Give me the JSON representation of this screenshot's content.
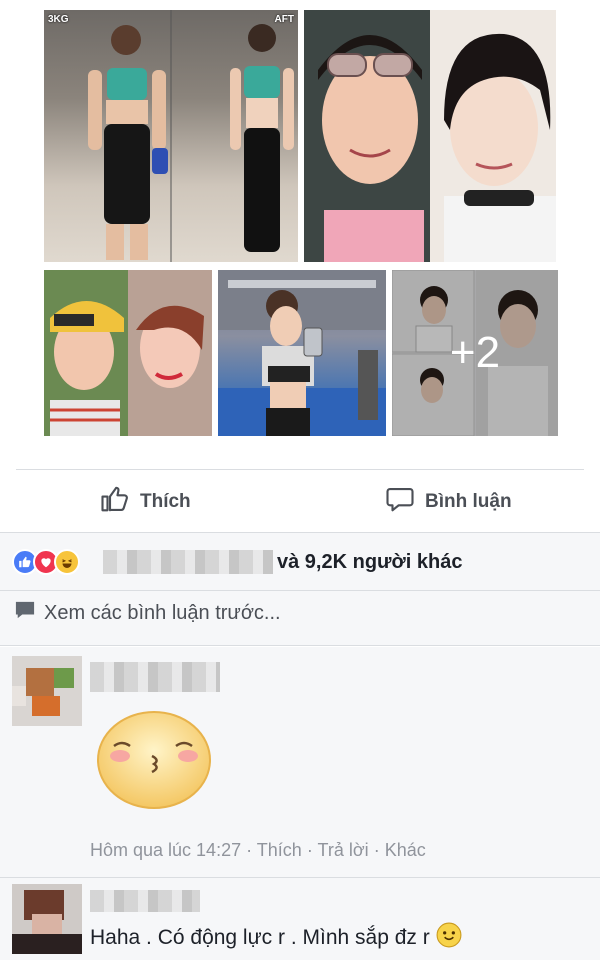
{
  "photos": {
    "before_label": "3KG",
    "after_label": "AFT",
    "more_count": "+2"
  },
  "actions": {
    "like_label": "Thích",
    "comment_label": "Bình luận"
  },
  "reactions": {
    "icons": [
      "like-icon",
      "love-icon",
      "haha-icon"
    ],
    "summary": "và 9,2K người khác"
  },
  "view_previous": "Xem các bình luận trước...",
  "comments": [
    {
      "sticker": "blush-kiss-sticker",
      "time": "Hôm qua lúc 14:27",
      "like": "Thích",
      "reply": "Trả lời",
      "more": "Khác",
      "sep": "·"
    },
    {
      "text": "Haha . Có động lực r . Mình sắp đz r"
    }
  ],
  "colors": {
    "like_blue": "#4a7cf7",
    "love_red": "#f0354f",
    "haha_yellow": "#f7c43b",
    "meta_gray": "#90949c"
  }
}
